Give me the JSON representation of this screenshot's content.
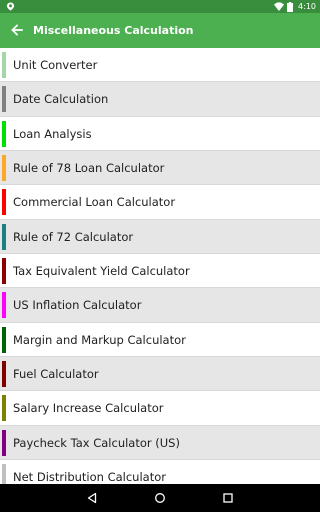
{
  "status_bar": {
    "time": "4:10"
  },
  "app_bar": {
    "title": "Miscellaneous Calculation"
  },
  "items": [
    {
      "label": "Unit Converter",
      "color": "#a5d6a7"
    },
    {
      "label": "Date Calculation",
      "color": "#808080"
    },
    {
      "label": "Loan Analysis",
      "color": "#00e000"
    },
    {
      "label": "Rule of 78 Loan Calculator",
      "color": "#ffa726"
    },
    {
      "label": "Commercial Loan Calculator",
      "color": "#ff0000"
    },
    {
      "label": "Rule of 72 Calculator",
      "color": "#1e7f7f"
    },
    {
      "label": "Tax Equivalent Yield Calculator",
      "color": "#8b0000"
    },
    {
      "label": "US Inflation Calculator",
      "color": "#ff00ff"
    },
    {
      "label": "Margin and Markup Calculator",
      "color": "#006400"
    },
    {
      "label": "Fuel Calculator",
      "color": "#800000"
    },
    {
      "label": "Salary Increase Calculator",
      "color": "#808000"
    },
    {
      "label": "Paycheck Tax Calculator (US)",
      "color": "#800080"
    },
    {
      "label": "Net Distribution Calculator",
      "color": "#c0c0c0"
    }
  ]
}
